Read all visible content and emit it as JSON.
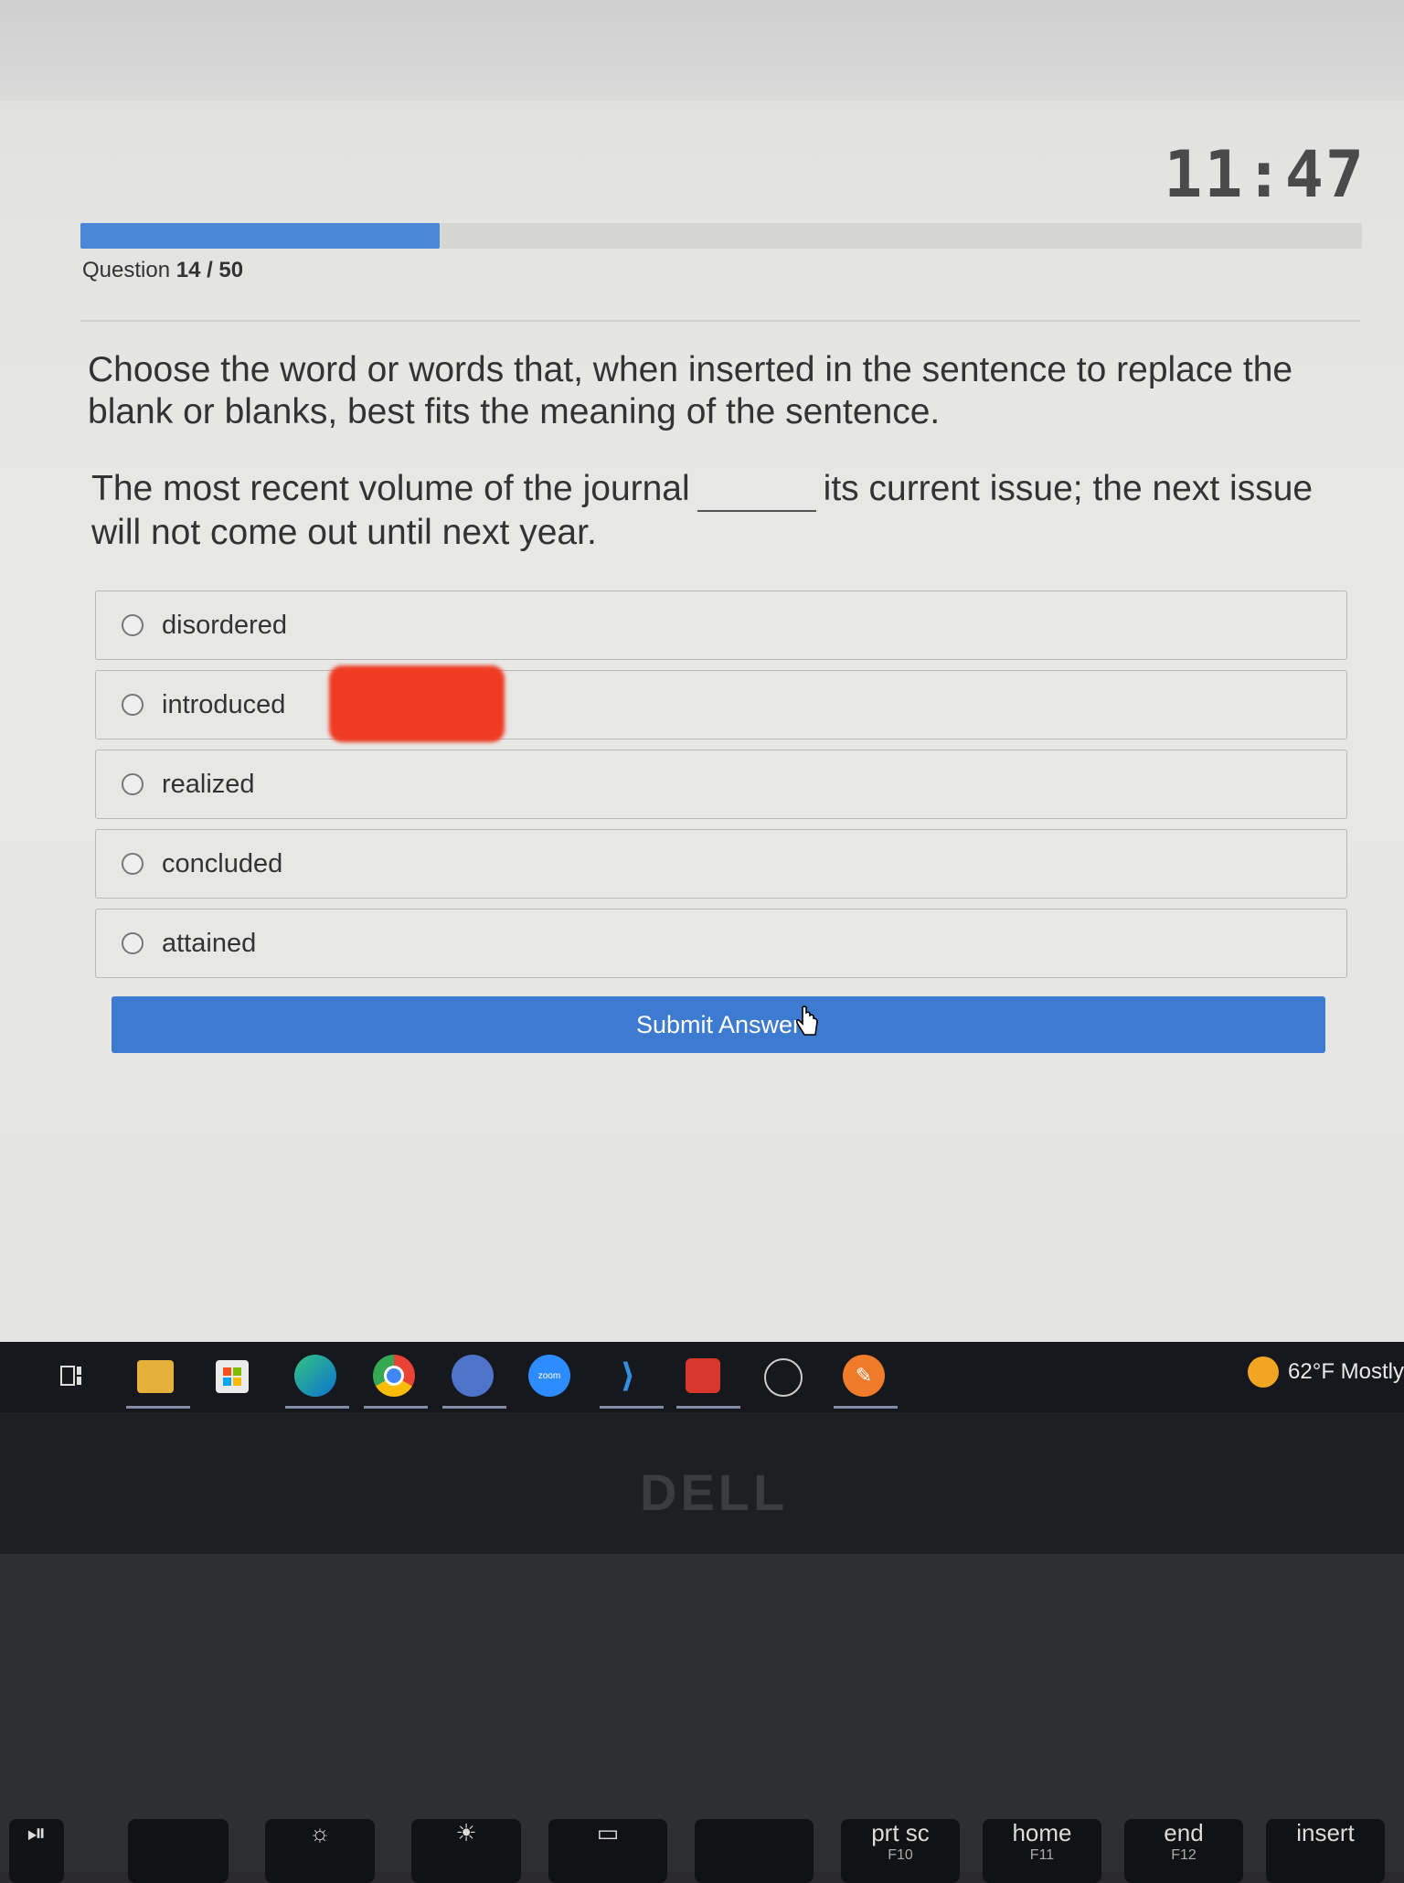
{
  "timer": "11:47",
  "progress": {
    "fraction": 0.28
  },
  "question": {
    "prefix": "Question",
    "number": "14 / 50"
  },
  "instructions": "Choose the word or words that, when inserted in the sentence to replace the blank or blanks, best fits the meaning of the sentence.",
  "sentence": {
    "before": "The most recent volume of the journal",
    "after": "its current issue; the next issue will not come out until next year."
  },
  "options": [
    {
      "label": "disordered"
    },
    {
      "label": "introduced"
    },
    {
      "label": "realized"
    },
    {
      "label": "concluded"
    },
    {
      "label": "attained"
    }
  ],
  "submit_label": "Submit Answer",
  "taskbar": {
    "weather": "62°F Mostly",
    "icons": [
      "task-view-icon",
      "file-explorer-icon",
      "store-icon",
      "edge-icon",
      "chrome-icon",
      "app-icon",
      "zoom-icon",
      "vscode-icon",
      "app-icon",
      "app-icon",
      "paint-icon"
    ]
  },
  "zoom_label": "zoom",
  "brand": "DELL",
  "keyboard": [
    {
      "label": "prt sc",
      "sub": "F10"
    },
    {
      "label": "home",
      "sub": "F11"
    },
    {
      "label": "end",
      "sub": "F12"
    },
    {
      "label": "insert",
      "sub": ""
    }
  ]
}
